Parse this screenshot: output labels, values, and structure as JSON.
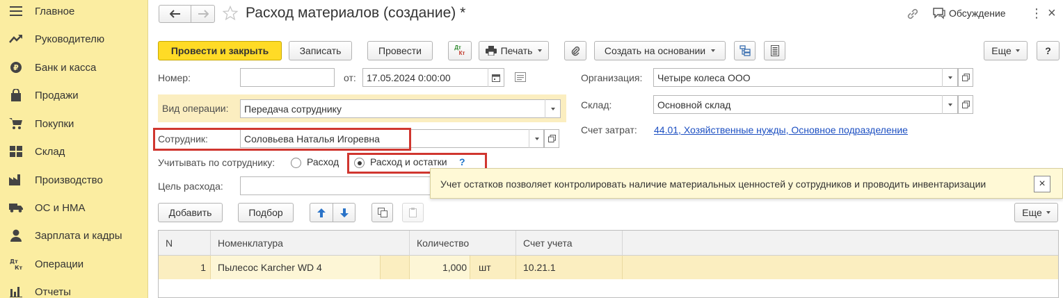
{
  "sidebar": {
    "items": [
      {
        "label": "Главное",
        "icon": "menu-icon"
      },
      {
        "label": "Руководителю",
        "icon": "chart-trend-icon"
      },
      {
        "label": "Банк и касса",
        "icon": "ruble-coin-icon"
      },
      {
        "label": "Продажи",
        "icon": "shopping-bag-icon"
      },
      {
        "label": "Покупки",
        "icon": "cart-icon"
      },
      {
        "label": "Склад",
        "icon": "warehouse-icon"
      },
      {
        "label": "Производство",
        "icon": "factory-icon"
      },
      {
        "label": "ОС и НМА",
        "icon": "truck-icon"
      },
      {
        "label": "Зарплата и кадры",
        "icon": "person-icon"
      },
      {
        "label": "Операции",
        "icon": "dt-kt-icon"
      },
      {
        "label": "Отчеты",
        "icon": "bar-chart-icon"
      }
    ]
  },
  "header": {
    "title": "Расход материалов (создание) *",
    "discussion_label": "Обсуждение"
  },
  "toolbar": {
    "post_close_label": "Провести и закрыть",
    "save_label": "Записать",
    "post_label": "Провести",
    "dtkt_top": "Дт",
    "dtkt_bottom": "Кт",
    "print_label": "Печать",
    "create_based_label": "Создать на основании",
    "more_label": "Еще",
    "help_label": "?"
  },
  "form": {
    "number_label": "Номер:",
    "number_value": "",
    "date_label": "от:",
    "date_value": "17.05.2024  0:00:00",
    "org_label": "Организация:",
    "org_value": "Четыре колеса ООО",
    "operation_label": "Вид операции:",
    "operation_value": "Передача сотруднику",
    "warehouse_label": "Склад:",
    "warehouse_value": "Основной склад",
    "cost_account_label": "Счет затрат:",
    "cost_account_value": "44.01, Хозяйственные нужды, Основное подразделение",
    "employee_label": "Сотрудник:",
    "employee_value": "Соловьева Наталья Игоревна",
    "track_label": "Учитывать по сотруднику:",
    "radio_expense": "Расход",
    "radio_expense_balance": "Расход и остатки",
    "help_mark": "?",
    "purpose_label": "Цель расхода:",
    "purpose_value": ""
  },
  "tooltip": {
    "text": "Учет остатков позволяет контролировать наличие материальных ценностей у сотрудников и проводить инвентаризации",
    "close": "×"
  },
  "table_toolbar": {
    "add_label": "Добавить",
    "pick_label": "Подбор",
    "more_label": "Еще"
  },
  "table": {
    "columns": [
      "N",
      "Номенклатура",
      "Количество",
      "Счет учета"
    ],
    "rows": [
      {
        "n": "1",
        "item": "Пылесос Karcher WD 4",
        "qty": "1,000",
        "unit": "шт",
        "account": "10.21.1"
      }
    ]
  },
  "colors": {
    "sidebar_bg": "#fbeda1",
    "primary_button": "#ffdb26",
    "highlight_red": "#d0362f",
    "link": "#1c4fc2",
    "row_selected": "#fbeec0"
  }
}
